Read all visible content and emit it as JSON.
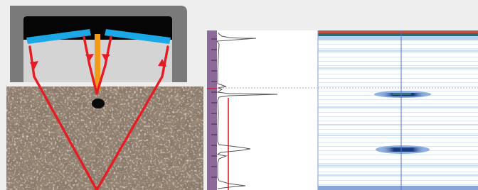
{
  "figure": {
    "panels": [
      {
        "id": "probe_diagram",
        "kind": "dual-element ultrasonic probe over specimen with reflector"
      },
      {
        "id": "a_scan",
        "kind": "A-scan waveform trace"
      },
      {
        "id": "b_scan",
        "kind": "B-scan image with two defect indications"
      }
    ],
    "colors": {
      "background": "#eeeeee",
      "probe_housing": "#7a7a7a",
      "probe_face": "#d4d4d4",
      "probe_cavity": "#050505",
      "elements": "#1aa9e6",
      "acoustic_barrier": "#f29a1c",
      "beam_paths": "#e61c24",
      "specimen": "#8a7a6a",
      "ruler": "#8e6a9c",
      "gate_line": "#e61c24",
      "cursor_line": "#5a6ed8",
      "scan_top_band": "#c05040",
      "indication": "#1a3a80"
    }
  }
}
